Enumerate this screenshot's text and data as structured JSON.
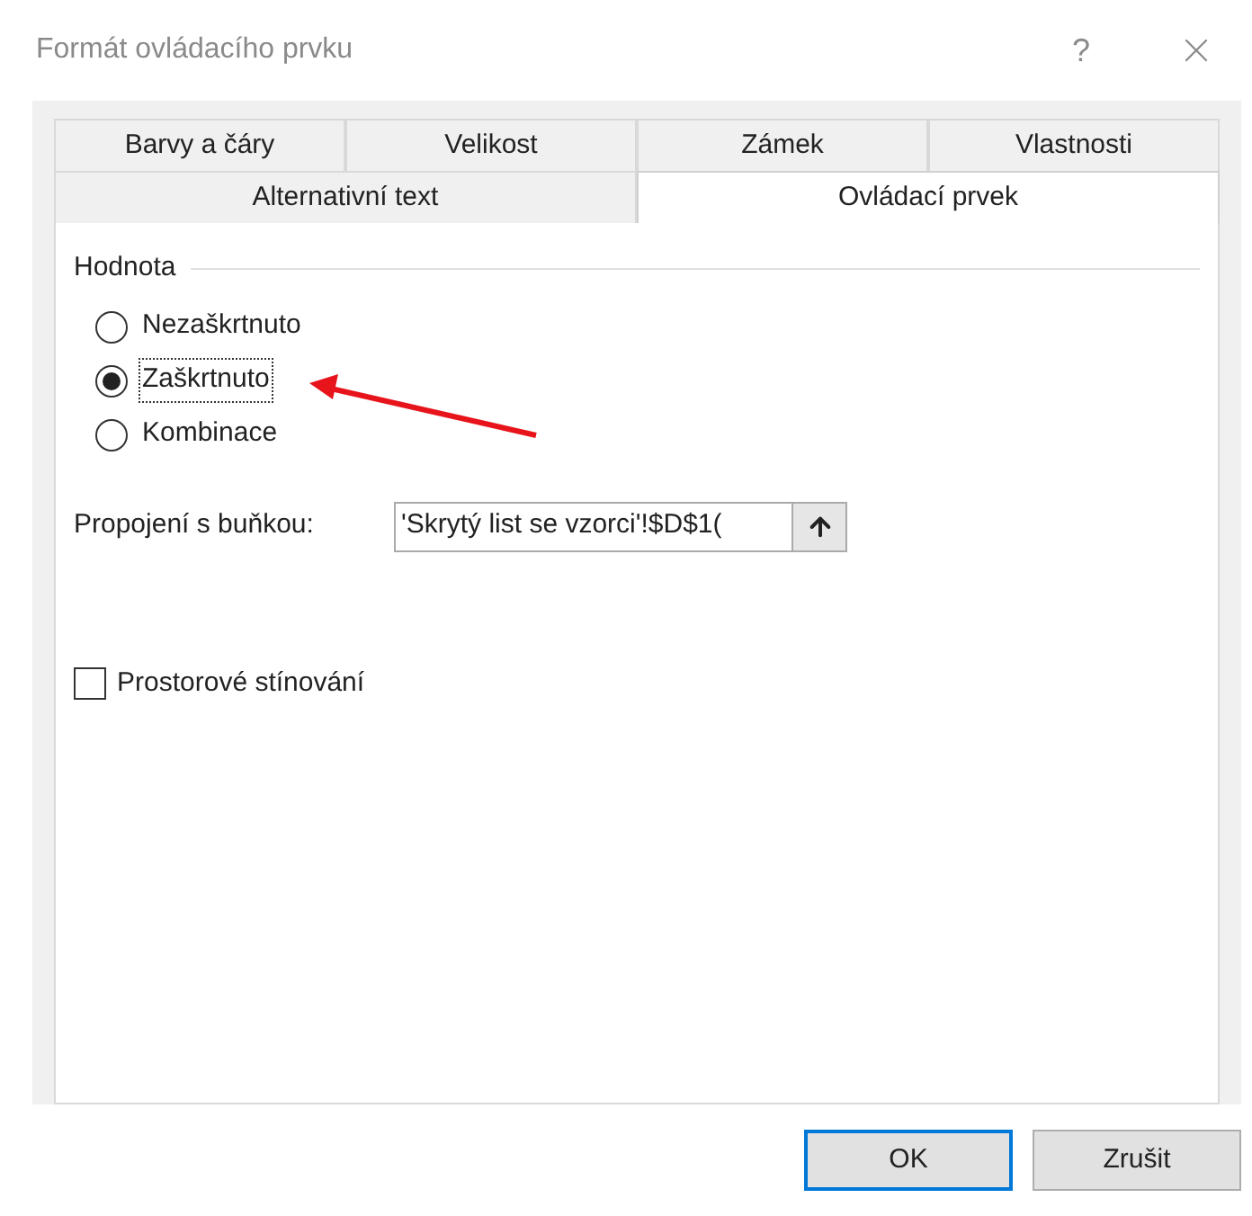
{
  "window": {
    "title": "Formát ovládacího prvku",
    "help": "?"
  },
  "tabs": [
    [
      {
        "label": "Barvy a čáry",
        "selected": false
      },
      {
        "label": "Velikost",
        "selected": false
      },
      {
        "label": "Zámek",
        "selected": false
      },
      {
        "label": "Vlastnosti",
        "selected": false
      }
    ],
    [
      {
        "label": "Alternativní text",
        "selected": false
      },
      {
        "label": "Ovládací prvek",
        "selected": true
      }
    ]
  ],
  "value_group": {
    "title": "Hodnota",
    "options": [
      {
        "label": "Nezaškrtnuto",
        "selected": false,
        "focused": false
      },
      {
        "label": "Zaškrtnuto",
        "selected": true,
        "focused": true
      },
      {
        "label": "Kombinace",
        "selected": false,
        "focused": false
      }
    ]
  },
  "cell_link": {
    "label": "Propojení s buňkou:",
    "value": "'Skrytý list se vzorci'!$D$1("
  },
  "shading": {
    "label": "Prostorové stínování",
    "checked": false
  },
  "buttons": [
    {
      "label": "OK",
      "default": true
    },
    {
      "label": "Zrušit",
      "default": false
    }
  ]
}
